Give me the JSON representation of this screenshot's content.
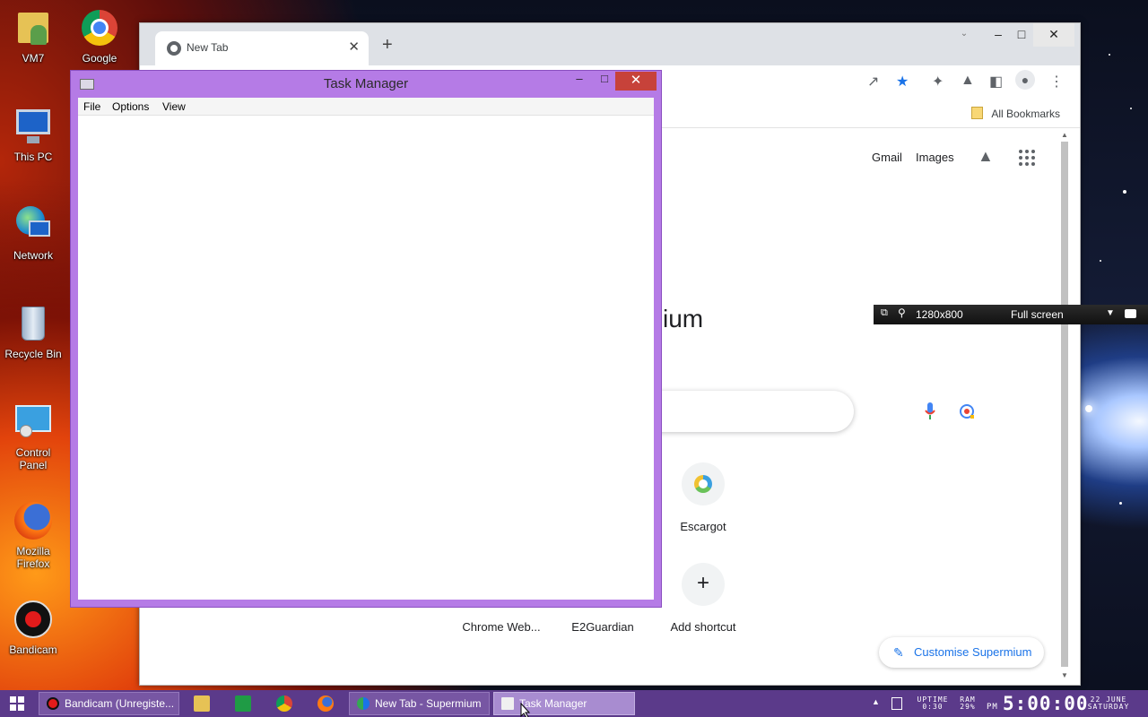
{
  "desktop": {
    "icons": [
      {
        "label": "VM7",
        "icon": "folder-user-icon"
      },
      {
        "label": "Google Chrome",
        "icon": "chrome-icon"
      },
      {
        "label": "This PC",
        "icon": "computer-icon"
      },
      {
        "label": "Network",
        "icon": "network-icon"
      },
      {
        "label": "Recycle Bin",
        "icon": "recycle-bin-icon"
      },
      {
        "label": "Control Panel",
        "icon": "control-panel-icon"
      },
      {
        "label": "Mozilla Firefox",
        "icon": "firefox-icon"
      },
      {
        "label": "Bandicam",
        "icon": "bandicam-icon"
      }
    ]
  },
  "browser": {
    "tab_title": "New Tab",
    "tab_close": "✕",
    "new_tab": "+",
    "bookmarks_label": "All Bookmarks",
    "links": {
      "gmail": "Gmail",
      "images": "Images"
    },
    "brand_partial": "ium",
    "shortcuts": [
      {
        "label": "Escargot"
      },
      {
        "label": "Chrome Web..."
      },
      {
        "label": "E2Guardian"
      },
      {
        "label": "Add shortcut"
      }
    ],
    "customise_label": "Customise Supermium",
    "colors": {
      "accent": "#1a73e8",
      "star": "#1a73e8"
    }
  },
  "bandicam_bar": {
    "resolution": "1280x800",
    "mode": "Full screen"
  },
  "task_manager": {
    "title": "Task Manager",
    "menu": [
      "File",
      "Options",
      "View"
    ],
    "frame_color": "#b57be6"
  },
  "taskbar": {
    "buttons": [
      {
        "label": "Bandicam (Unregiste...",
        "icon": "bandicam-icon"
      },
      {
        "label": "New Tab - Supermium",
        "icon": "supermium-icon"
      },
      {
        "label": "Task Manager",
        "icon": "task-manager-icon"
      }
    ],
    "uptime_label": "UPTIME",
    "uptime_value": "0:30",
    "ram_label": "RAM",
    "ram_value": "29%",
    "ampm": "PM",
    "time": "5:00:00",
    "date_line1": "22 JUNE",
    "date_line2": "SATURDAY",
    "bg_color": "#5b3a8a"
  }
}
